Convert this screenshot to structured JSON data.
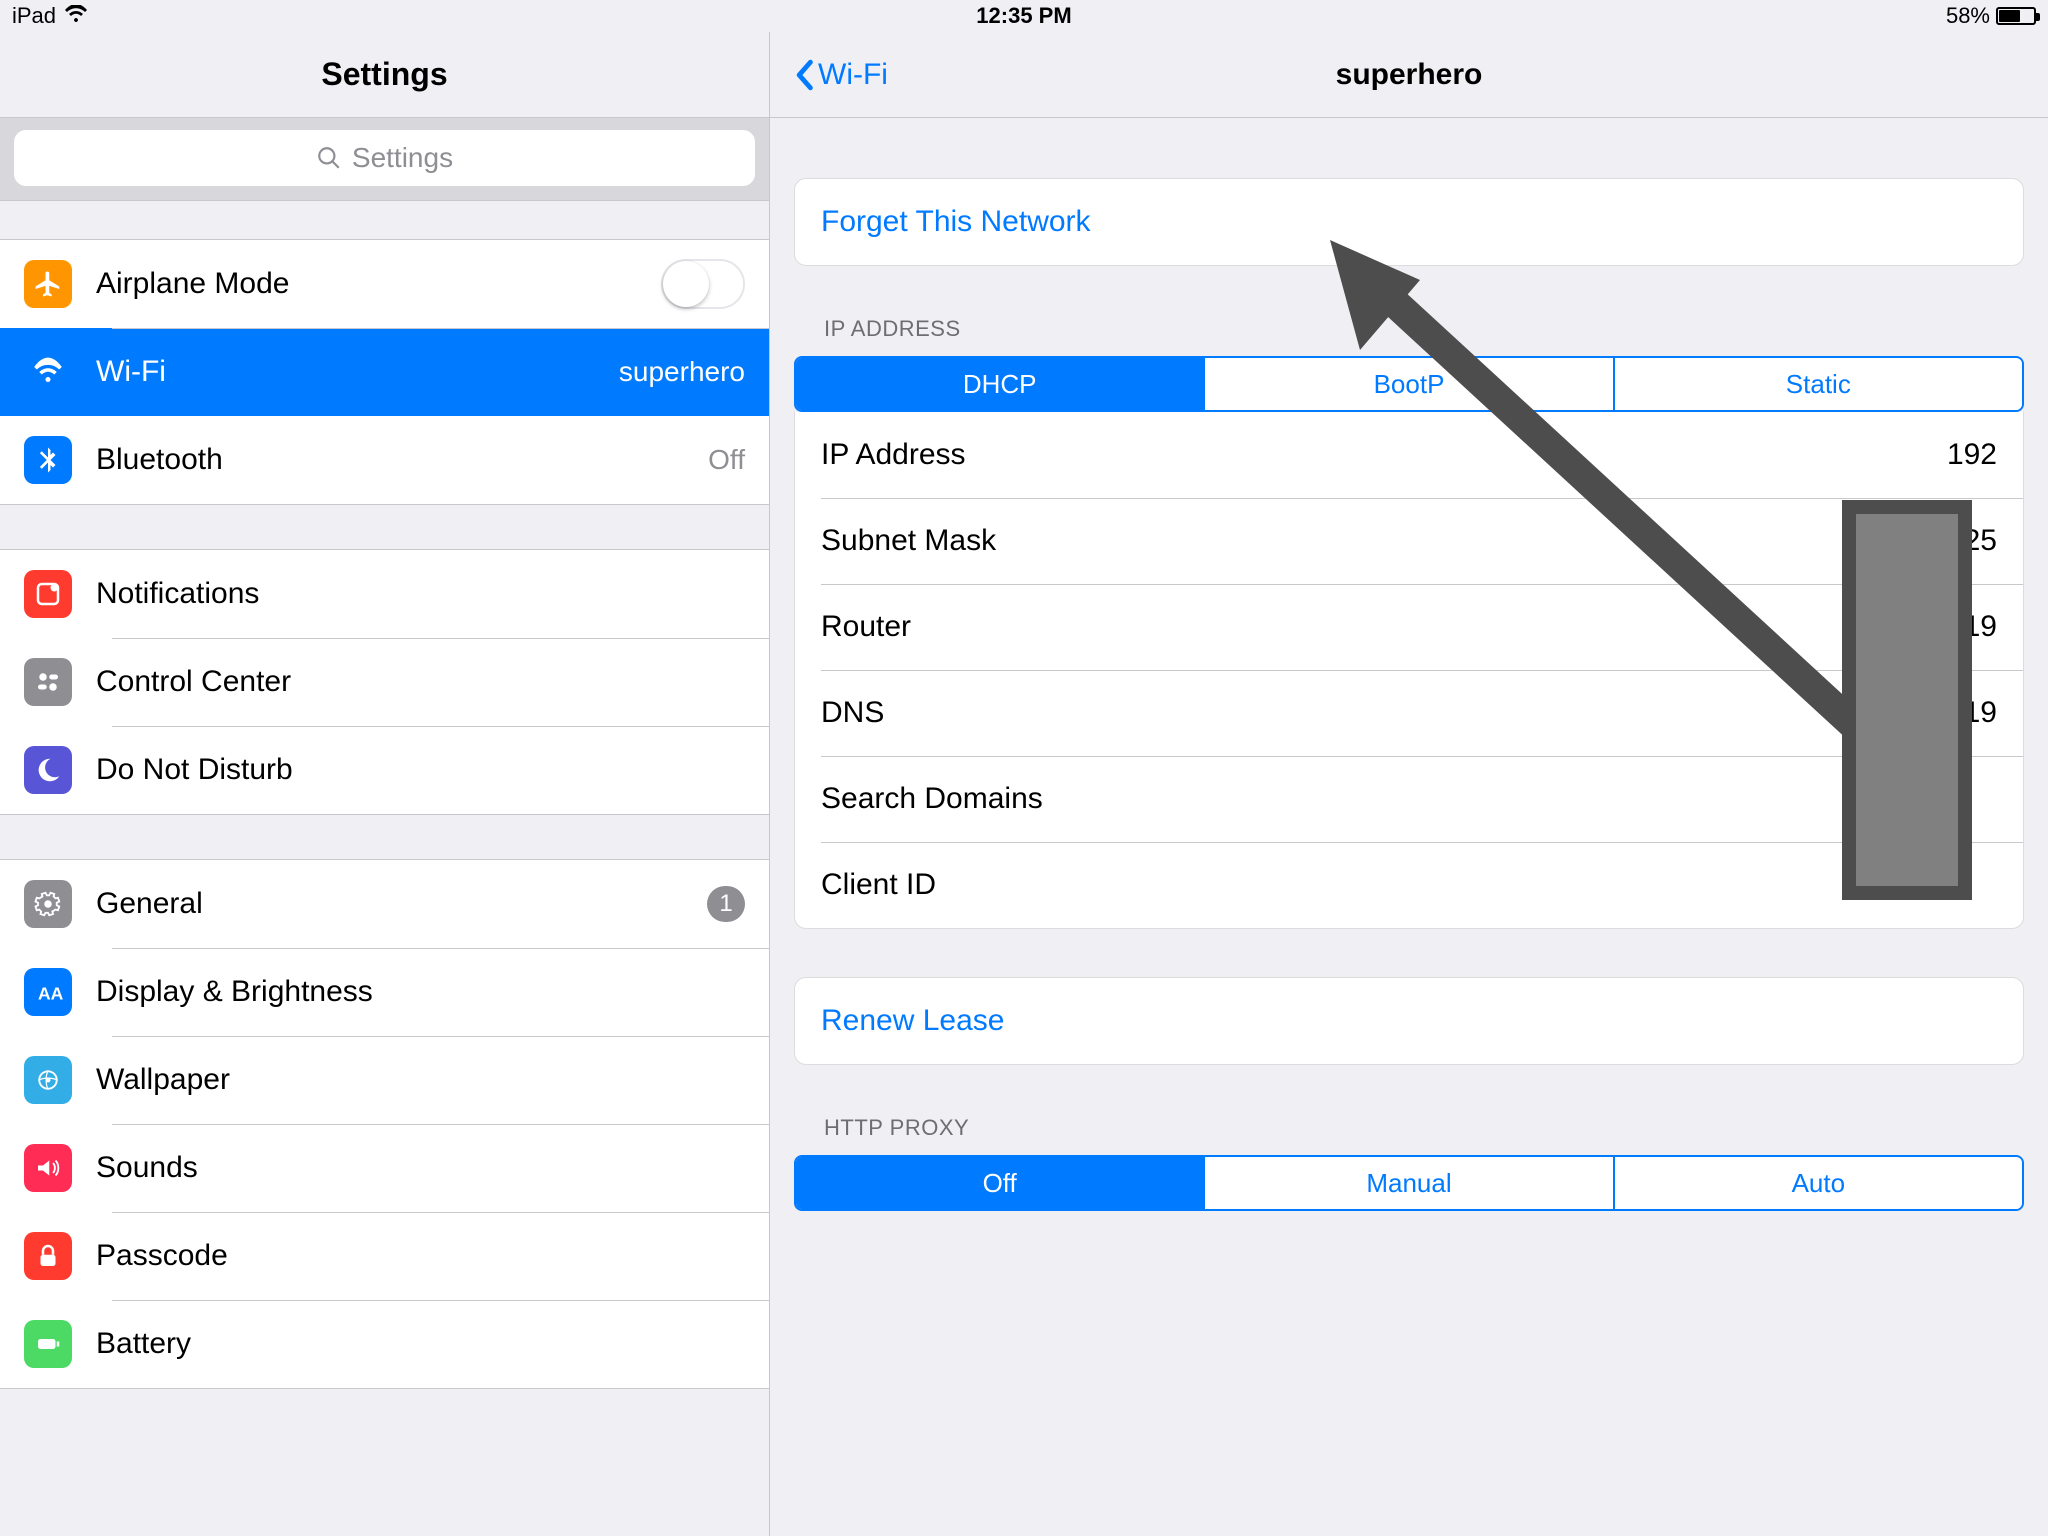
{
  "statusbar": {
    "device": "iPad",
    "time": "12:35 PM",
    "battery_pct": "58%"
  },
  "sidebar": {
    "title": "Settings",
    "search_placeholder": "Settings",
    "groups": [
      [
        {
          "id": "airplane",
          "label": "Airplane Mode",
          "accessory": "toggle"
        },
        {
          "id": "wifi",
          "label": "Wi-Fi",
          "value": "superhero",
          "selected": true
        },
        {
          "id": "bluetooth",
          "label": "Bluetooth",
          "value": "Off"
        }
      ],
      [
        {
          "id": "notifications",
          "label": "Notifications"
        },
        {
          "id": "controlcenter",
          "label": "Control Center"
        },
        {
          "id": "dnd",
          "label": "Do Not Disturb"
        }
      ],
      [
        {
          "id": "general",
          "label": "General",
          "badge": "1"
        },
        {
          "id": "display",
          "label": "Display & Brightness"
        },
        {
          "id": "wallpaper",
          "label": "Wallpaper"
        },
        {
          "id": "sounds",
          "label": "Sounds"
        },
        {
          "id": "passcode",
          "label": "Passcode"
        },
        {
          "id": "battery",
          "label": "Battery"
        }
      ]
    ]
  },
  "detail": {
    "back_label": "Wi-Fi",
    "title": "superhero",
    "forget_label": "Forget This Network",
    "ip_section_label": "IP ADDRESS",
    "ip_tabs": [
      "DHCP",
      "BootP",
      "Static"
    ],
    "ip_tab_active": 0,
    "ip_rows": [
      {
        "label": "IP Address",
        "value": "192"
      },
      {
        "label": "Subnet Mask",
        "value": "255.25"
      },
      {
        "label": "Router",
        "value": "19"
      },
      {
        "label": "DNS",
        "value": "19"
      },
      {
        "label": "Search Domains",
        "value": ""
      },
      {
        "label": "Client ID",
        "value": ""
      }
    ],
    "renew_label": "Renew Lease",
    "proxy_section_label": "HTTP PROXY",
    "proxy_tabs": [
      "Off",
      "Manual",
      "Auto"
    ],
    "proxy_tab_active": 0
  }
}
